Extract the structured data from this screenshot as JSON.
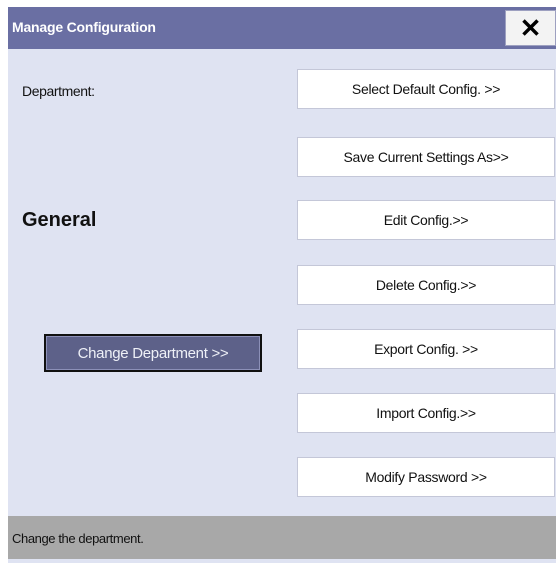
{
  "window": {
    "title": "Manage Configuration",
    "close_label": "✕"
  },
  "left": {
    "department_label": "Department:",
    "department_name": "General",
    "change_button": "Change Department >>"
  },
  "actions": {
    "select_default": "Select Default Config. >>",
    "save_current": "Save Current Settings As>>",
    "edit": "Edit Config.>>",
    "delete": "Delete Config.>>",
    "export": "Export Config. >>",
    "import": "Import Config.>>",
    "modify_password": "Modify Password >>"
  },
  "status": {
    "message": "Change the department."
  },
  "colors": {
    "title_bar": "#6a6fa3",
    "dialog_bg": "#dfe3f2",
    "change_button_bg": "#5d6189",
    "status_bg": "#a8a8a8"
  }
}
